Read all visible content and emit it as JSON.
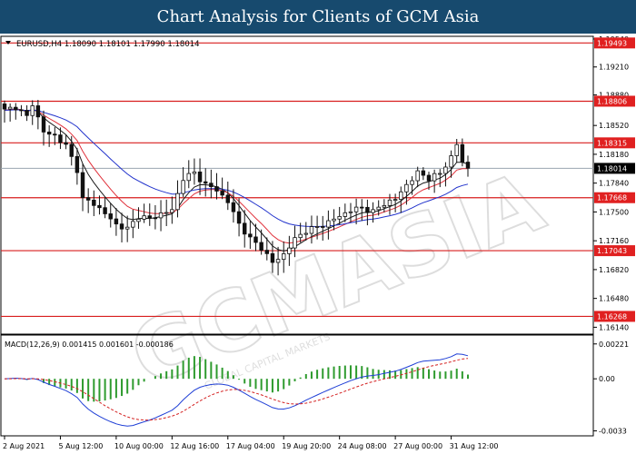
{
  "banner": {
    "title": "Chart Analysis for Clients of GCM Asia"
  },
  "watermark": {
    "brand": "GCMASIA",
    "tagline": "GLOBAL CAPITAL MARKETS"
  },
  "chart_data": {
    "type": "candlestick",
    "symbol_header": "EURUSD,H4 1.18090 1.18101 1.17990 1.18014",
    "price_scale": {
      "range": [
        1.1608,
        1.1955
      ],
      "ticks": [
        "1.19540",
        "1.19210",
        "1.18880",
        "1.18520",
        "1.18180",
        "1.17840",
        "1.17500",
        "1.17160",
        "1.16820",
        "1.16480",
        "1.16140"
      ]
    },
    "current_price": "1.18014",
    "levels": [
      "1.19493",
      "1.18806",
      "1.18315",
      "1.17668",
      "1.17043",
      "1.16268"
    ],
    "x_labels": [
      "2 Aug 2021",
      "5 Aug 12:00",
      "10 Aug 00:00",
      "12 Aug 16:00",
      "17 Aug 04:00",
      "19 Aug 20:00",
      "24 Aug 08:00",
      "27 Aug 00:00",
      "31 Aug 12:00"
    ],
    "x_label_bar_index": [
      0,
      10,
      20,
      30,
      40,
      50,
      60,
      70,
      80
    ],
    "bars_total": 84,
    "close_path": [
      [
        0,
        1.187
      ],
      [
        2,
        1.1874
      ],
      [
        4,
        1.1862
      ],
      [
        5,
        1.1878
      ],
      [
        7,
        1.1844
      ],
      [
        9,
        1.184
      ],
      [
        11,
        1.1828
      ],
      [
        13,
        1.18
      ],
      [
        14,
        1.1765
      ],
      [
        16,
        1.176
      ],
      [
        18,
        1.1748
      ],
      [
        20,
        1.1735
      ],
      [
        22,
        1.173
      ],
      [
        24,
        1.1745
      ],
      [
        26,
        1.1742
      ],
      [
        28,
        1.1748
      ],
      [
        30,
        1.1752
      ],
      [
        32,
        1.179
      ],
      [
        34,
        1.1796
      ],
      [
        36,
        1.1782
      ],
      [
        38,
        1.1776
      ],
      [
        40,
        1.1762
      ],
      [
        42,
        1.1736
      ],
      [
        44,
        1.1718
      ],
      [
        46,
        1.1708
      ],
      [
        48,
        1.169
      ],
      [
        50,
        1.17
      ],
      [
        52,
        1.1718
      ],
      [
        54,
        1.1728
      ],
      [
        56,
        1.1732
      ],
      [
        58,
        1.1738
      ],
      [
        60,
        1.1745
      ],
      [
        62,
        1.1752
      ],
      [
        64,
        1.1755
      ],
      [
        66,
        1.175
      ],
      [
        68,
        1.176
      ],
      [
        70,
        1.1765
      ],
      [
        72,
        1.1782
      ],
      [
        74,
        1.1796
      ],
      [
        76,
        1.179
      ],
      [
        78,
        1.1795
      ],
      [
        80,
        1.1815
      ],
      [
        81,
        1.183
      ],
      [
        82,
        1.1808
      ],
      [
        83,
        1.18014
      ]
    ],
    "macd": {
      "label": "MACD(12,26,9) 0.001415 0.001601 -0.000186",
      "range": [
        -0.0035,
        0.0026
      ],
      "ticks": [
        "0.00221",
        "0.00",
        "-0.0033"
      ]
    }
  }
}
